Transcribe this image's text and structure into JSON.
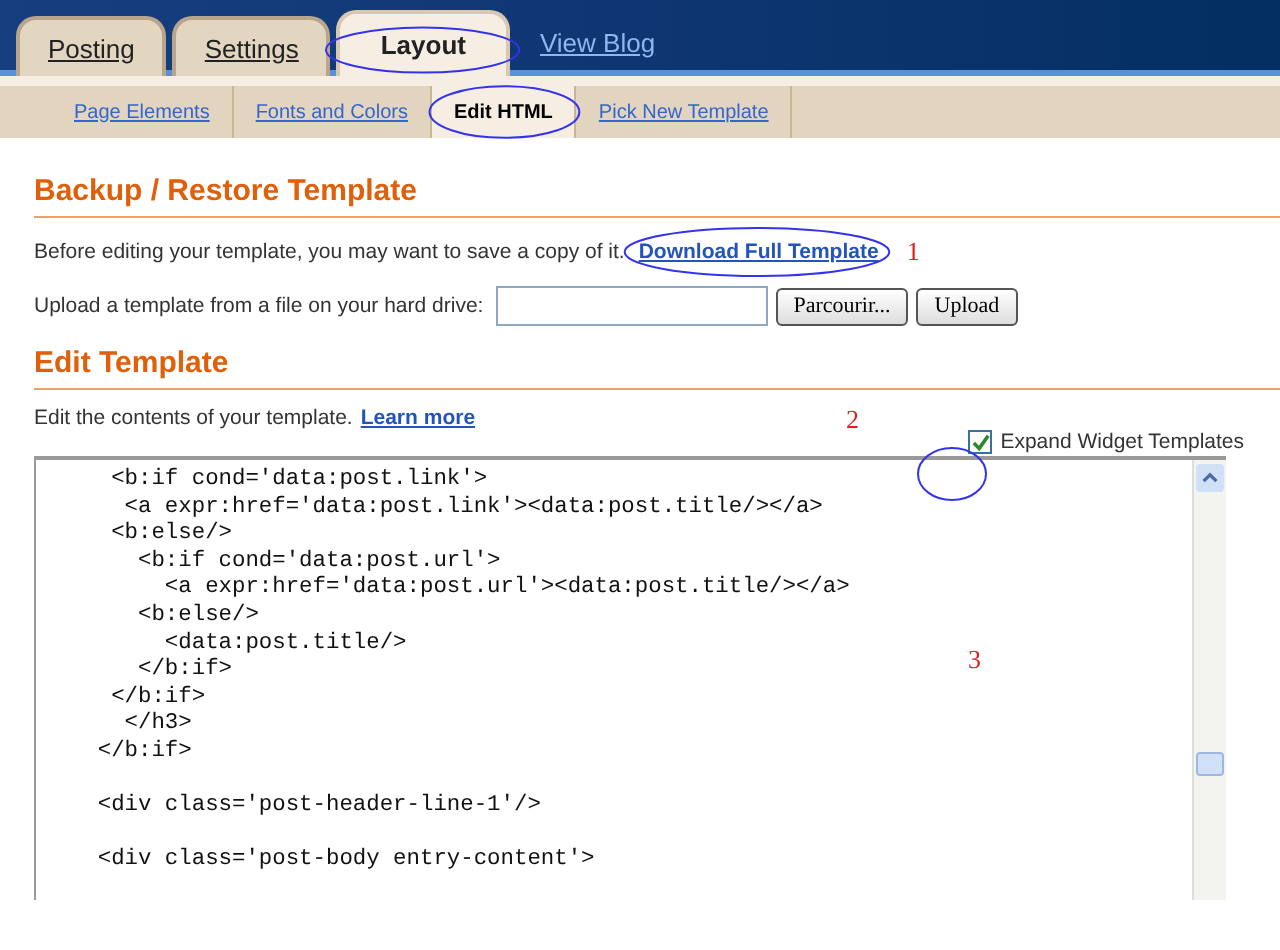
{
  "tabs": [
    {
      "label": "Posting",
      "selected": false
    },
    {
      "label": "Settings",
      "selected": false
    },
    {
      "label": "Layout",
      "selected": true
    }
  ],
  "view_blog": "View Blog",
  "subtabs": [
    {
      "label": "Page Elements",
      "selected": false
    },
    {
      "label": "Fonts and Colors",
      "selected": false
    },
    {
      "label": "Edit HTML",
      "selected": true
    },
    {
      "label": "Pick New Template",
      "selected": false
    }
  ],
  "backup": {
    "heading": "Backup / Restore Template",
    "intro": "Before editing your template, you may want to save a copy of it.",
    "download_link": "Download Full Template",
    "upload_label": "Upload a template from a file on your hard drive:",
    "browse_button": "Parcourir...",
    "upload_button": "Upload"
  },
  "edit": {
    "heading": "Edit Template",
    "intro": "Edit the contents of your template.",
    "learn_more": "Learn more",
    "expand_widgets": {
      "label": "Expand Widget Templates",
      "checked": true
    },
    "code": "     <b:if cond='data:post.link'>\n      <a expr:href='data:post.link'><data:post.title/></a>\n     <b:else/>\n       <b:if cond='data:post.url'>\n         <a expr:href='data:post.url'><data:post.title/></a>\n       <b:else/>\n         <data:post.title/>\n       </b:if>\n     </b:if>\n      </h3>\n    </b:if>\n\n    <div class='post-header-line-1'/>\n\n    <div class='post-body entry-content'>"
  },
  "annotations": [
    "1",
    "2",
    "3"
  ]
}
